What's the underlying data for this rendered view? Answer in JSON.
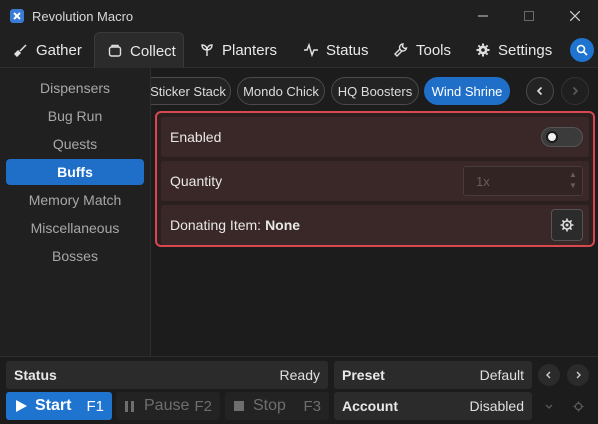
{
  "app": {
    "title": "Revolution Macro"
  },
  "nav": {
    "tabs": [
      {
        "label": "Gather",
        "icon": "shovel-icon"
      },
      {
        "label": "Collect",
        "icon": "collect-icon",
        "active": true
      },
      {
        "label": "Planters",
        "icon": "planter-icon"
      },
      {
        "label": "Status",
        "icon": "pulse-icon"
      },
      {
        "label": "Tools",
        "icon": "wrench-icon"
      },
      {
        "label": "Settings",
        "icon": "gear-icon"
      }
    ]
  },
  "sidebar": {
    "items": [
      {
        "label": "Dispensers"
      },
      {
        "label": "Bug Run"
      },
      {
        "label": "Quests"
      },
      {
        "label": "Buffs",
        "active": true
      },
      {
        "label": "Memory Match"
      },
      {
        "label": "Miscellaneous"
      },
      {
        "label": "Bosses"
      }
    ]
  },
  "chips": {
    "items": [
      {
        "label": "Sticker Stack"
      },
      {
        "label": "Mondo Chick"
      },
      {
        "label": "HQ Boosters"
      },
      {
        "label": "Wind Shrine",
        "active": true
      }
    ]
  },
  "panel": {
    "enabled_label": "Enabled",
    "enabled": true,
    "quantity_label": "Quantity",
    "quantity_placeholder": "1x",
    "donating_label": "Donating Item:",
    "donating_value": "None"
  },
  "status": {
    "status_label": "Status",
    "status_value": "Ready",
    "preset_label": "Preset",
    "preset_value": "Default",
    "account_label": "Account",
    "account_value": "Disabled"
  },
  "controls": {
    "start_label": "Start",
    "start_key": "F1",
    "pause_label": "Pause",
    "pause_key": "F2",
    "stop_label": "Stop",
    "stop_key": "F3"
  },
  "colors": {
    "accent": "#1f6fc9",
    "highlight": "#d9474f"
  }
}
